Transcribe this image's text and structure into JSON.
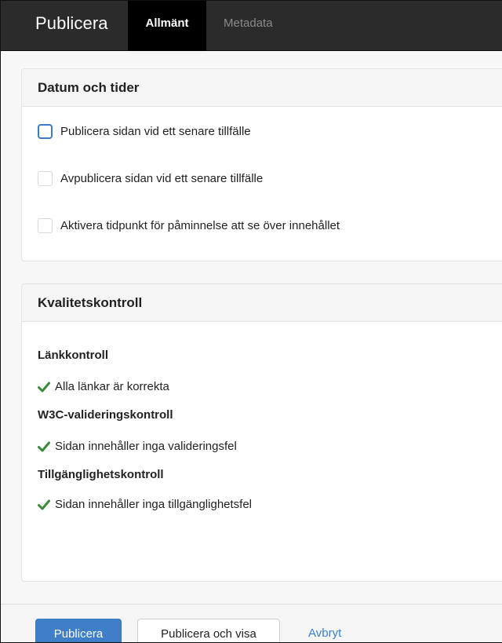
{
  "header": {
    "title": "Publicera",
    "tabs": [
      {
        "label": "Allmänt",
        "active": true
      },
      {
        "label": "Metadata",
        "active": false
      }
    ]
  },
  "dates_panel": {
    "title": "Datum och tider",
    "options": [
      {
        "label": "Publicera sidan vid ett senare tillfälle",
        "checked": false,
        "focused": true
      },
      {
        "label": "Avpublicera sidan vid ett senare tillfälle",
        "checked": false,
        "focused": false
      },
      {
        "label": "Aktivera tidpunkt för påminnelse att se över innehållet",
        "checked": false,
        "focused": false
      }
    ]
  },
  "quality_panel": {
    "title": "Kvalitetskontroll",
    "sections": [
      {
        "heading": "Länkkontroll",
        "result": "Alla länkar är korrekta"
      },
      {
        "heading": "W3C-valideringskontroll",
        "result": "Sidan innehåller inga valideringsfel"
      },
      {
        "heading": "Tillgänglighetskontroll",
        "result": "Sidan innehåller inga tillgänglighetsfel"
      }
    ]
  },
  "footer": {
    "publish_label": "Publicera",
    "publish_view_label": "Publicera och visa",
    "cancel_label": "Avbryt"
  },
  "colors": {
    "accent": "#3f7fc8",
    "success": "#3a8a3a",
    "topbar": "#2b2b2b"
  },
  "icons": {
    "check": "checkmark-icon"
  }
}
